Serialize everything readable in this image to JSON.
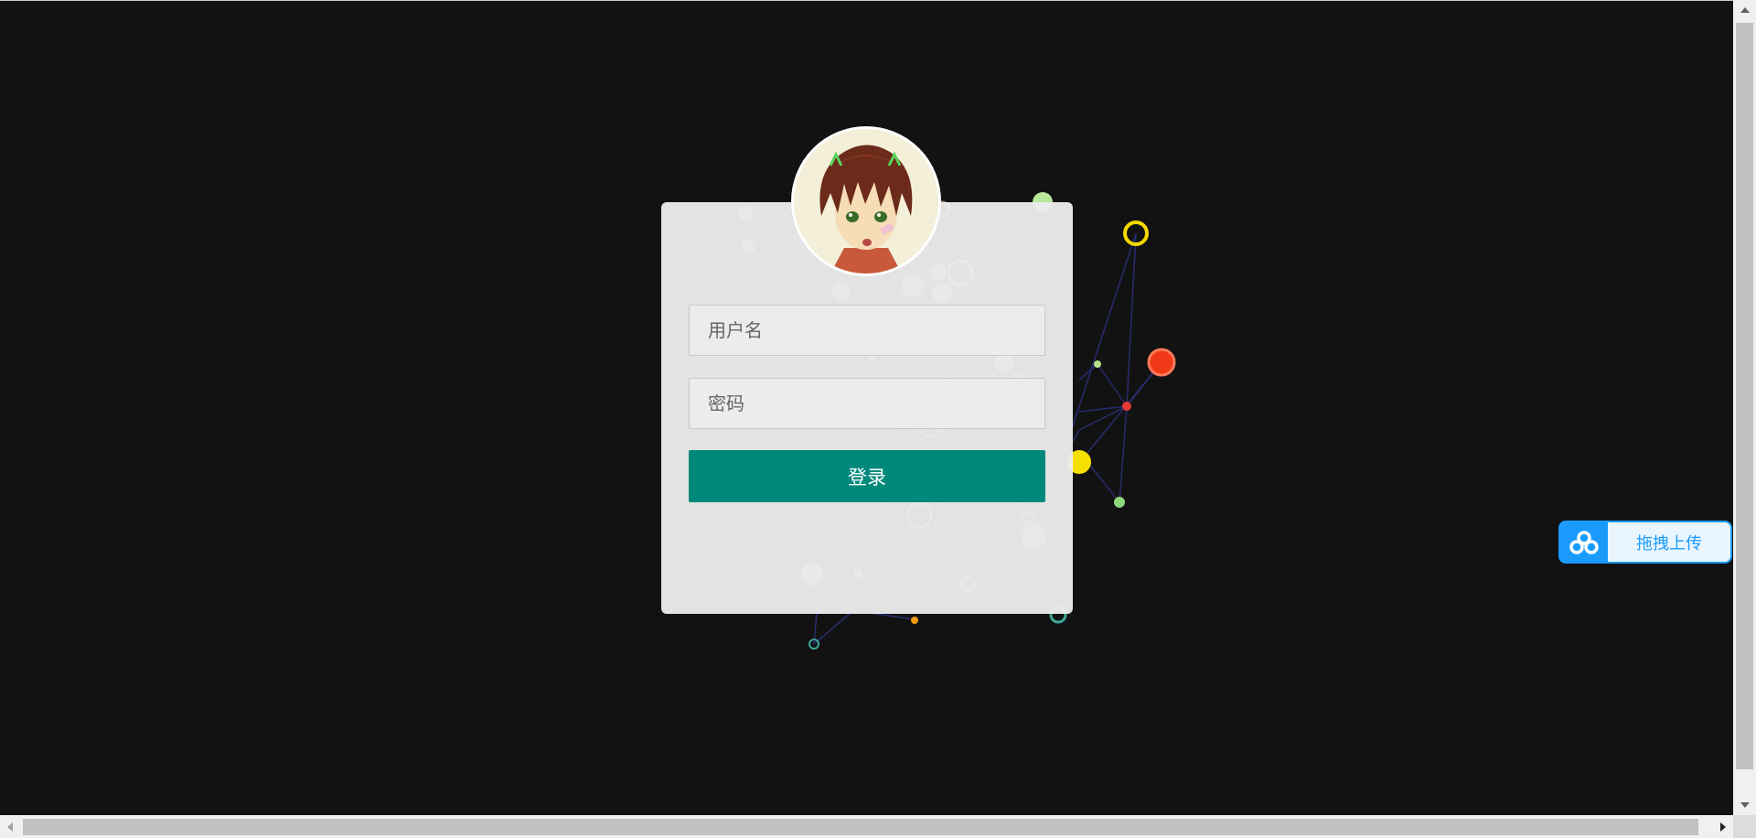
{
  "login": {
    "username_placeholder": "用户名",
    "password_placeholder": "密码",
    "submit_label": "登录"
  },
  "upload_widget": {
    "label": "拖拽上传",
    "icon": "cloud-upload-icon",
    "accent_color": "#1a9bfc"
  },
  "colors": {
    "page_background": "#121212",
    "card_background": "#ececec",
    "button_color": "#00897b"
  },
  "avatar": {
    "icon": "anime-avatar-icon"
  }
}
